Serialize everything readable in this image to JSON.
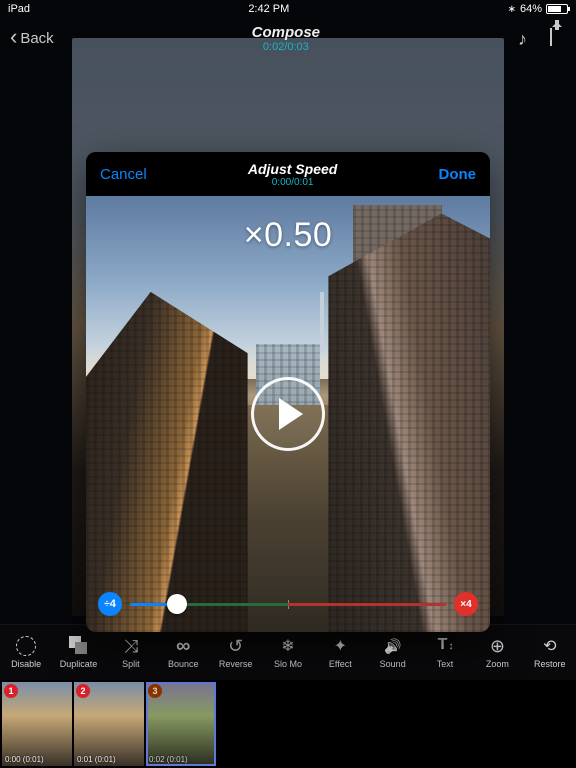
{
  "status": {
    "device": "iPad",
    "time": "2:42 PM",
    "battery": "64%"
  },
  "nav": {
    "back": "Back",
    "title": "Compose",
    "subtitle": "0:02/0:03"
  },
  "modal": {
    "cancel": "Cancel",
    "done": "Done",
    "title": "Adjust Speed",
    "subtitle": "0:00/0:01",
    "speed_readout": "×0.50",
    "slow_cap": "4",
    "fast_cap": "4"
  },
  "toolbar": {
    "disable": "Disable",
    "duplicate": "Duplicate",
    "split": "Split",
    "bounce": "Bounce",
    "reverse": "Reverse",
    "slomo": "Slo Mo",
    "effect": "Effect",
    "sound": "Sound",
    "text": "Text",
    "zoom": "Zoom",
    "restore": "Restore"
  },
  "thumbs": [
    {
      "index": "1",
      "time": "0:00 (0:01)"
    },
    {
      "index": "2",
      "time": "0:01 (0:01)"
    },
    {
      "index": "3",
      "time": "0:02 (0:01)"
    }
  ]
}
